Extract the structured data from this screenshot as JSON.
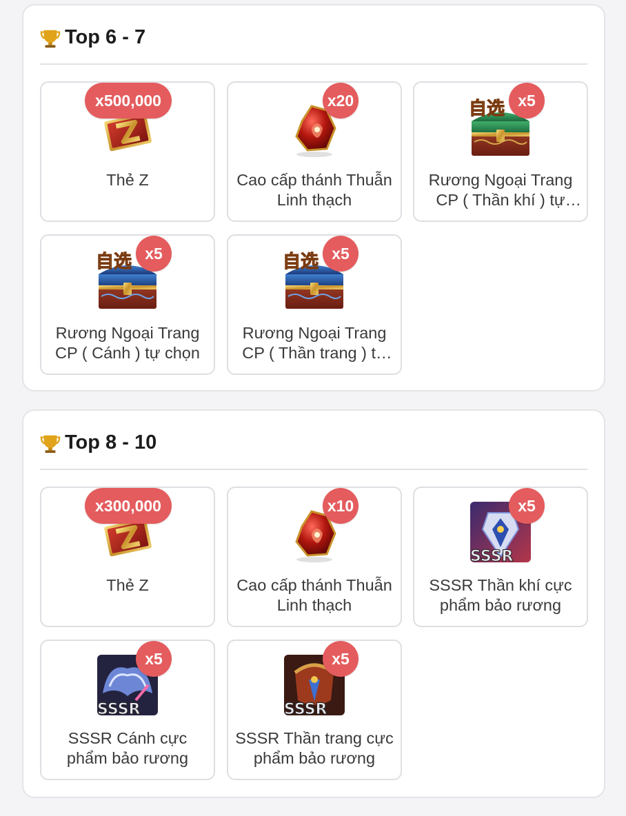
{
  "sections": [
    {
      "title": "Top 6 - 7",
      "items": [
        {
          "name": "Thẻ Z",
          "qty": "x500,000",
          "icon": "z-card-icon"
        },
        {
          "name": "Cao cấp thánh Thuẫn Linh thạch",
          "qty": "x20",
          "icon": "red-crystal-icon"
        },
        {
          "name": "Rương Ngoại Trang CP ( Thần khí ) tự chọn",
          "qty": "x5",
          "icon": "green-chest-icon"
        },
        {
          "name": "Rương Ngoại Trang CP ( Cánh ) tự chọn",
          "qty": "x5",
          "icon": "blue-chest-icon"
        },
        {
          "name": "Rương Ngoại Trang CP ( Thần trang ) tự chọn",
          "qty": "x5",
          "icon": "blue-chest-icon"
        }
      ]
    },
    {
      "title": "Top 8 - 10",
      "items": [
        {
          "name": "Thẻ Z",
          "qty": "x300,000",
          "icon": "z-card-icon"
        },
        {
          "name": "Cao cấp thánh Thuẫn Linh thạch",
          "qty": "x10",
          "icon": "red-crystal-icon"
        },
        {
          "name": "SSSR Thần khí cực phẩm bảo rương",
          "qty": "x5",
          "icon": "sssr-weapon-icon"
        },
        {
          "name": "SSSR Cánh cực phẩm bảo rương",
          "qty": "x5",
          "icon": "sssr-wing-icon"
        },
        {
          "name": "SSSR Thần trang cực phẩm bảo rương",
          "qty": "x5",
          "icon": "sssr-armor-icon"
        }
      ]
    }
  ],
  "icon_overlays": {
    "chest_tag": "自选",
    "rarity_tag": "SSSR"
  },
  "colors": {
    "badge": "#e45c5e",
    "card_border": "#dedee3",
    "section_border": "#e4e4e8"
  }
}
